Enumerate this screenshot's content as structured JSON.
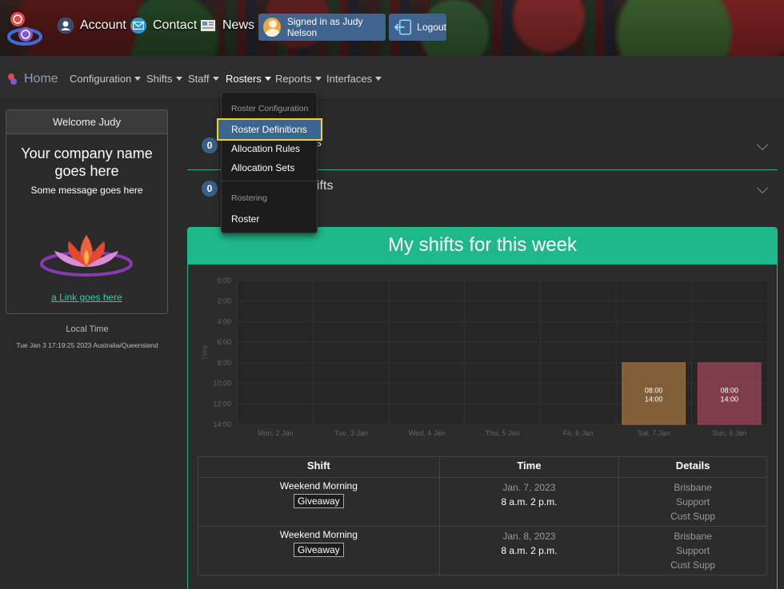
{
  "banner": {
    "account_label": "Account",
    "contact_label": "Contact",
    "news_label": "News",
    "signed_in_label": "Signed in as Judy Nelson",
    "logout_label": "Logout"
  },
  "navbar": {
    "home_label": "Home",
    "items": [
      {
        "label": "Configuration"
      },
      {
        "label": "Shifts"
      },
      {
        "label": "Staff"
      },
      {
        "label": "Rosters"
      },
      {
        "label": "Reports"
      },
      {
        "label": "Interfaces"
      }
    ]
  },
  "dropdown": {
    "header_1": "Roster Configuration",
    "items_1": [
      "Roster Definitions",
      "Allocation Rules",
      "Allocation Sets"
    ],
    "header_2": "Rostering",
    "items_2": [
      "Roster"
    ]
  },
  "sidebar": {
    "welcome": "Welcome Judy",
    "company": "Your company name goes here",
    "message": "Some message goes here",
    "link": "a Link goes here",
    "local_label": "Local Time",
    "local_time": "Tue Jan 3 17:19:25 2023 Australia/Queensland"
  },
  "accordions": [
    {
      "count": "0",
      "title_visible": "s"
    },
    {
      "count": "0",
      "title_visible": "ifts"
    }
  ],
  "shifts_card": {
    "title": "My shifts for this week"
  },
  "chart_data": {
    "type": "bar",
    "ylabel": "Time",
    "y_ticks": [
      "0:00",
      "2:00",
      "4:00",
      "6:00",
      "8:00",
      "10:00",
      "12:00",
      "14:00"
    ],
    "categories": [
      "Mon, 2 Jan",
      "Tue, 3 Jan",
      "Wed, 4 Jan",
      "Thu, 5 Jan",
      "Fri, 6 Jan",
      "Sat, 7 Jan",
      "Sun, 8 Jan"
    ],
    "ylim": [
      0,
      14
    ],
    "y_reversed": true,
    "shifts": [
      {
        "day": "Sat, 7 Jan",
        "start": 8,
        "end": 14,
        "start_label": "08:00",
        "end_label": "14:00",
        "color": "#a2713c"
      },
      {
        "day": "Sun, 8 Jan",
        "start": 8,
        "end": 14,
        "start_label": "08:00",
        "end_label": "14:00",
        "color": "#9c4558"
      }
    ]
  },
  "table": {
    "headers": [
      "Shift",
      "Time",
      "Details"
    ],
    "rows": [
      {
        "shift": "Weekend Morning",
        "tag": "Giveaway",
        "date": "Jan. 7, 2023",
        "time": "8 a.m. 2 p.m.",
        "details": [
          "Brisbane",
          "Support",
          "Cust Supp"
        ]
      },
      {
        "shift": "Weekend Morning",
        "tag": "Giveaway",
        "date": "Jan. 8, 2023",
        "time": "8 a.m. 2 p.m.",
        "details": [
          "Brisbane",
          "Support",
          "Cust Supp"
        ]
      }
    ]
  },
  "colors": {
    "accent": "#1fb88a",
    "button": "#41648f",
    "badge": "#3a5f86",
    "highlight": "#f5d21f"
  }
}
